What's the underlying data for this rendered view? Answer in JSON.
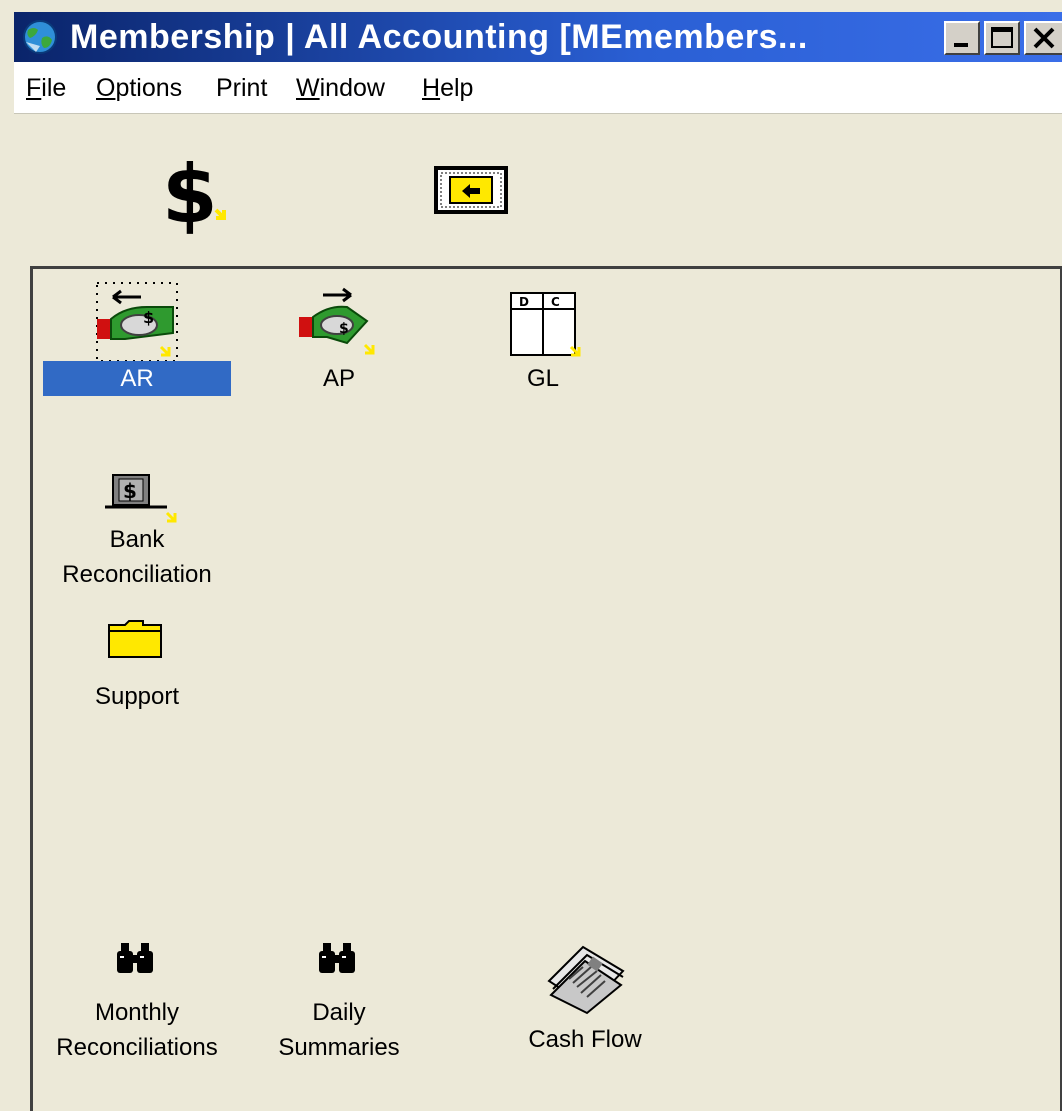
{
  "window": {
    "title": "Membership | All Accounting   [MEmembers...",
    "minimize_icon": "minimize-icon",
    "maximize_icon": "maximize-icon",
    "close_icon": "close-icon"
  },
  "menu": {
    "items": [
      {
        "label": "File",
        "mnemonic": "F"
      },
      {
        "label": "Options",
        "mnemonic": "O"
      },
      {
        "label": "Print",
        "mnemonic": ""
      },
      {
        "label": "Window",
        "mnemonic": "W"
      },
      {
        "label": "Help",
        "mnemonic": "H"
      }
    ]
  },
  "toolbar": {
    "items": [
      {
        "icon": "dollar-sign-icon"
      },
      {
        "icon": "up-folder-icon"
      }
    ]
  },
  "icons": {
    "ar": {
      "label": "AR",
      "icon": "receivables-hand-money-icon",
      "selected": true
    },
    "ap": {
      "label": "AP",
      "icon": "payables-hand-money-icon"
    },
    "gl": {
      "label": "GL",
      "icon": "ledger-debit-credit-icon"
    },
    "bank": {
      "label_line1": "Bank",
      "label_line2": "Reconciliation",
      "icon": "bank-dollar-icon"
    },
    "support": {
      "label": "Support",
      "icon": "folder-icon"
    },
    "monthly": {
      "label_line1": "Monthly",
      "label_line2": "Reconciliations",
      "icon": "binoculars-icon"
    },
    "daily": {
      "label_line1": "Daily",
      "label_line2": "Summaries",
      "icon": "binoculars-icon"
    },
    "cashflow": {
      "label": "Cash Flow",
      "icon": "newspaper-icon"
    }
  },
  "colors": {
    "title_bar": "#0a246a",
    "selection": "#316ac5",
    "background": "#ece9d8",
    "shortcut_arrow": "#ffe800"
  }
}
